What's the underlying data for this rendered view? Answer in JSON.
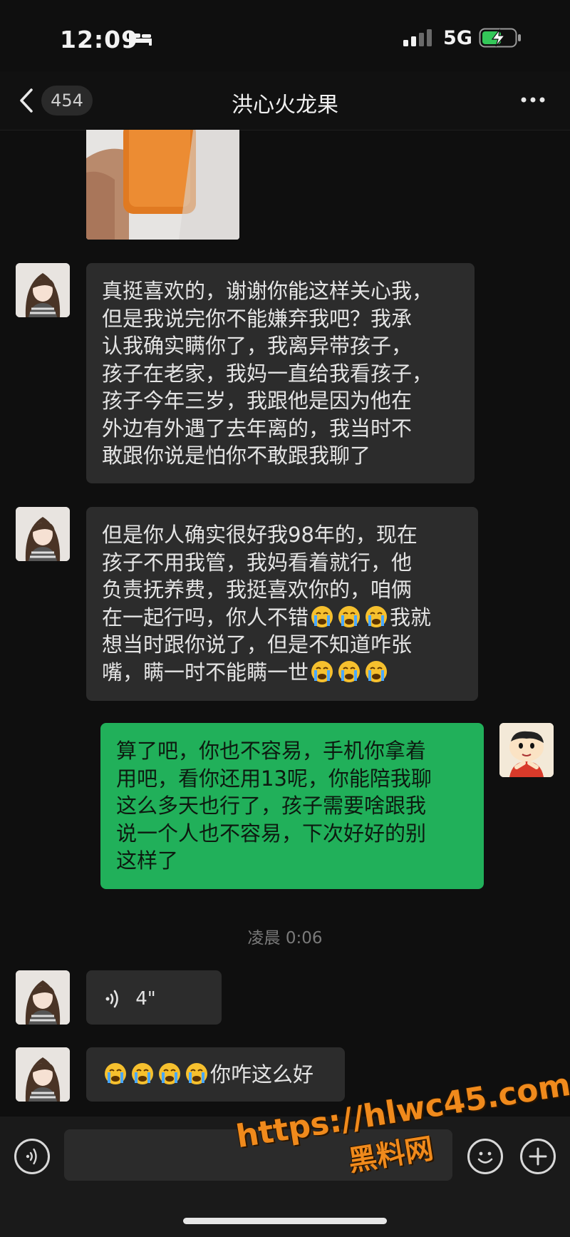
{
  "status_bar": {
    "time": "12:09",
    "network": "5G"
  },
  "header": {
    "unread_count": "454",
    "title": "洪心火龙果"
  },
  "messages": [
    {
      "text": "真挺喜欢的，谢谢你能这样关心我，\n但是我说完你不能嫌弃我吧？我承\n认我确实瞒你了，我离异带孩子，\n孩子在老家，我妈一直给我看孩子，\n孩子今年三岁，我跟他是因为他在\n外边有外遇了去年离的，我当时不\n敢跟你说是怕你不敢跟我聊了"
    },
    {
      "line1": "但是你人确实很好我98年的，现在",
      "line2": "孩子不用我管，我妈看着就行，他",
      "line3": "负责抚养费，我挺喜欢你的，咱俩",
      "line4a": "在一起行吗，你人不错",
      "line4b": "我就",
      "line5": "想当时跟你说了，但是不知道咋张",
      "line6": "嘴，瞒一时不能瞒一世"
    },
    {
      "text": "算了吧，你也不容易，手机你拿着\n用吧，看你还用13呢，你能陪我聊\n这么多天也行了，孩子需要啥跟我\n说一个人也不容易，下次好好的别\n这样了"
    },
    {
      "duration": "4\""
    },
    {
      "text": "你咋这么好"
    }
  ],
  "timestamp": "凌晨 0:06",
  "watermark": {
    "line1": "https://hlwc45.com",
    "line2": "黑料网"
  },
  "colors": {
    "sent_bubble": "#21b05a",
    "received_bubble": "#2c2c2c",
    "background": "#0f0f0f"
  }
}
